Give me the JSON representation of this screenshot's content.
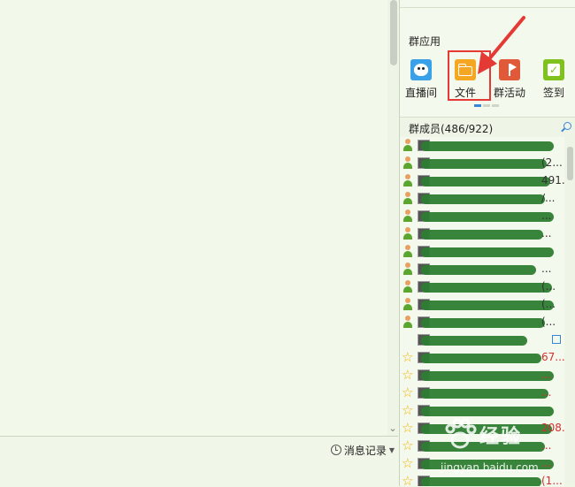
{
  "chat": {
    "history_button": "消息记录"
  },
  "apps": {
    "title": "群应用",
    "items": [
      {
        "label": "直播间",
        "icon": "live-broadcast-icon"
      },
      {
        "label": "文件",
        "icon": "folder-icon"
      },
      {
        "label": "群活动",
        "icon": "activity-flag-icon"
      },
      {
        "label": "签到",
        "icon": "checkin-check-icon"
      }
    ]
  },
  "members": {
    "title": "群成员(486/922)",
    "rows": [
      {
        "role": "person",
        "text": ""
      },
      {
        "role": "person",
        "text": "(2..."
      },
      {
        "role": "person",
        "text": "491..."
      },
      {
        "role": "person",
        "text": "/..."
      },
      {
        "role": "person",
        "text": "..."
      },
      {
        "role": "person",
        "text": "..."
      },
      {
        "role": "person",
        "text": ""
      },
      {
        "role": "person",
        "text": "..."
      },
      {
        "role": "person",
        "text": "(..."
      },
      {
        "role": "person",
        "text": "(..."
      },
      {
        "role": "person",
        "text": "(..."
      },
      {
        "role": "none",
        "text": ""
      },
      {
        "role": "star",
        "text": "67...",
        "red": true
      },
      {
        "role": "star",
        "text": "...",
        "red": true
      },
      {
        "role": "star",
        "text": "...",
        "red": true
      },
      {
        "role": "star",
        "text": "",
        "red": true
      },
      {
        "role": "star",
        "text": "208...",
        "red": true
      },
      {
        "role": "star",
        "text": "...",
        "red": true
      },
      {
        "role": "star",
        "text": "...",
        "red": true
      },
      {
        "role": "star",
        "text": "(1...",
        "red": true
      }
    ]
  },
  "watermark": {
    "brand": "经验",
    "url": "jingyan.baidu.com"
  },
  "colors": {
    "highlight": "#e53935",
    "accent_blue": "#3a86d6",
    "scribble": "#2e7d32"
  }
}
